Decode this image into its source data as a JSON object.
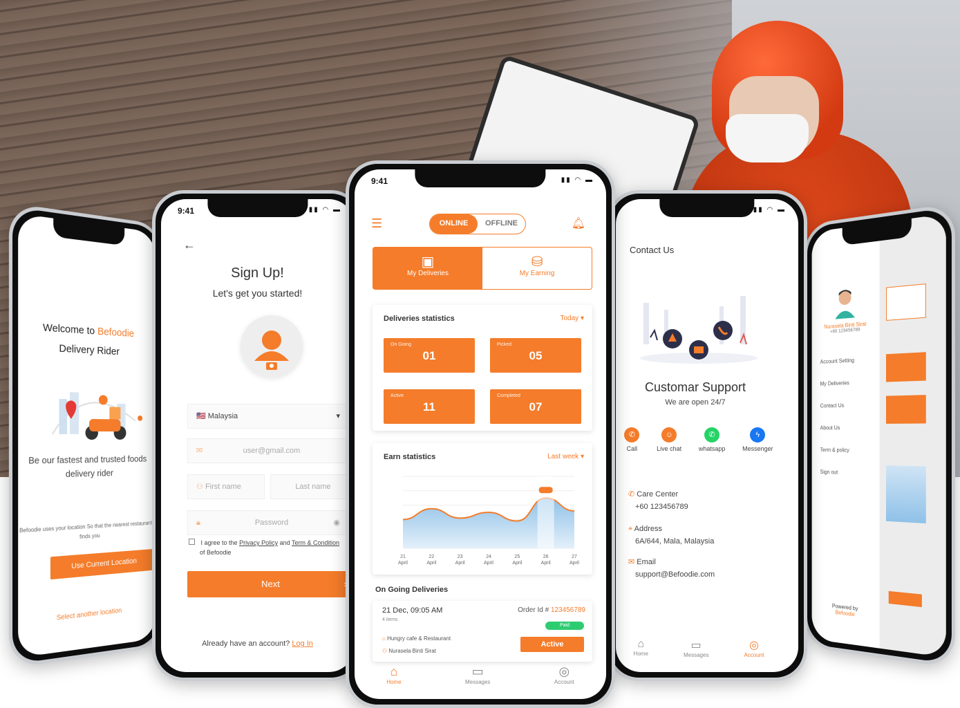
{
  "colors": {
    "accent": "#f47c2a",
    "success": "#2ecc71",
    "whatsapp": "#25d366",
    "messenger": "#1877f2"
  },
  "status_time": "9:41",
  "welcome": {
    "title_line1_prefix": "Welcome to",
    "brand": "Befoodie",
    "title_line2": "Delivery Rider",
    "tagline": "Be our fastest and trusted foods delivery rider",
    "note": "Befoodie uses your location So that the nearest restaurants finds you",
    "use_location_button": "Use Current Location",
    "other_location_link": "Select another location"
  },
  "signup": {
    "title": "Sign Up!",
    "subtitle": "Let's get you started!",
    "country": "Malaysia",
    "email_placeholder": "user@gmail.com",
    "first_name_placeholder": "First name",
    "last_name_placeholder": "Last name",
    "password_placeholder": "Password",
    "agree_prefix": "I agree to the",
    "privacy_link": "Privacy Policy",
    "and": "and",
    "terms_link": "Term & Condition",
    "agree_suffix": "of Befoodie",
    "next_button": "Next",
    "have_account": "Already have an account?",
    "login_link": "Log In"
  },
  "dashboard": {
    "toggle_online": "ONLINE",
    "toggle_offline": "OFFLINE",
    "tab_deliveries": "My Deliveries",
    "tab_earning": "My Earning",
    "deliveries_title": "Deliveries statistics",
    "deliveries_filter": "Today",
    "stats": [
      {
        "label": "On Going",
        "value": "01"
      },
      {
        "label": "Picked",
        "value": "05"
      },
      {
        "label": "Active",
        "value": "11"
      },
      {
        "label": "Completed",
        "value": "07"
      }
    ],
    "earn_title": "Earn statistics",
    "earn_filter": "Last week",
    "ongoing_title": "On Going Deliveries",
    "order": {
      "datetime": "21 Dec, 09:05 AM",
      "items": "4 items",
      "order_label": "Order Id #",
      "order_id": "123456789",
      "status": "Paid",
      "restaurant": "Hungry cafe & Restaurant",
      "customer": "Nurasela Binti Sirat",
      "action": "Active"
    },
    "nav": [
      {
        "icon": "home-icon",
        "label": "Home"
      },
      {
        "icon": "messages-icon",
        "label": "Messages"
      },
      {
        "icon": "account-icon",
        "label": "Account"
      }
    ]
  },
  "chart_data": {
    "type": "area",
    "title": "Earn statistics",
    "x": [
      "21 April",
      "22 April",
      "23 April",
      "24 April",
      "25 April",
      "26 April",
      "27 April"
    ],
    "series": [
      {
        "values": [
          40,
          55,
          42,
          50,
          38,
          70,
          52
        ]
      }
    ],
    "ylim": [
      0,
      100
    ],
    "highlight_index": 5,
    "color": "#f47c2a"
  },
  "support": {
    "header": "Contact Us",
    "title": "Customar Support",
    "subtitle": "We are open 24/7",
    "channels": [
      {
        "icon": "phone-icon",
        "label": "Call"
      },
      {
        "icon": "chat-icon",
        "label": "Live chat"
      },
      {
        "icon": "whatsapp-icon",
        "label": "whatsapp"
      },
      {
        "icon": "messenger-icon",
        "label": "Messenger"
      }
    ],
    "care_label": "Care Center",
    "care_value": "+60 123456789",
    "address_label": "Address",
    "address_value": "6A/644, Mala, Malaysia",
    "email_label": "Email",
    "email_value": "support@Befoodie.com",
    "nav": [
      "Home",
      "Messages",
      "Account"
    ]
  },
  "drawer": {
    "name": "Nurasela Binti Sirat",
    "phone": "+60 123456789",
    "items": [
      "Account Setting",
      "My Deliveries",
      "Contact Us",
      "About Us",
      "Term & policy",
      "Sign out"
    ],
    "powered_by": "Powered by",
    "brand": "Befoodie"
  }
}
